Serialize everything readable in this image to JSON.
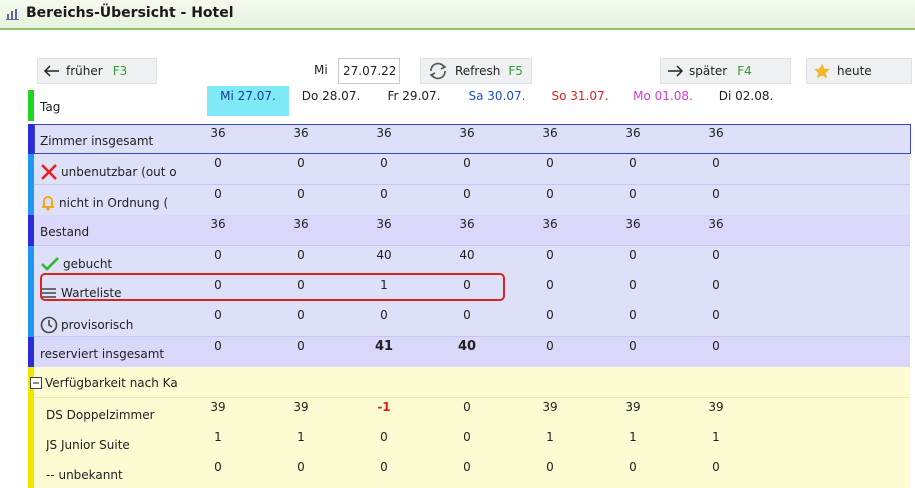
{
  "window": {
    "title": "Bereichs-Übersicht - Hotel"
  },
  "toolbar": {
    "earlier_label": "früher",
    "earlier_key": "F3",
    "date_prefix": "Mi",
    "date_value": "27.07.22",
    "refresh_label": "Refresh",
    "refresh_key": "F5",
    "later_label": "später",
    "later_key": "F4",
    "today_label": "heute"
  },
  "colors": {
    "accent_green": "#2f9e2f",
    "row_bar_blue": "#2b2bd9",
    "row_bar_lightblue": "#2196f3",
    "row_bar_yellow": "#f2e600",
    "negative": "#e02020",
    "highlight": "#d8261f"
  },
  "header": {
    "label": "Tag",
    "days": [
      {
        "label": "Mi 27.07.",
        "color": "#1a3a8a",
        "bg": "#7fe9f7"
      },
      {
        "label": "Do 28.07.",
        "color": "#222222",
        "bg": ""
      },
      {
        "label": "Fr 29.07.",
        "color": "#222222",
        "bg": ""
      },
      {
        "label": "Sa 30.07.",
        "color": "#1c4fd0",
        "bg": ""
      },
      {
        "label": "So 31.07.",
        "color": "#e02020",
        "bg": ""
      },
      {
        "label": "Mo 01.08.",
        "color": "#d43bd4",
        "bg": ""
      },
      {
        "label": "Di 02.08.",
        "color": "#222222",
        "bg": ""
      }
    ]
  },
  "rows": [
    {
      "label": "Zimmer insgesamt",
      "icon": "",
      "values": [
        "36",
        "36",
        "36",
        "36",
        "36",
        "36",
        "36"
      ]
    },
    {
      "label": "unbenutzbar (out o",
      "icon": "x-icon",
      "values": [
        "0",
        "0",
        "0",
        "0",
        "0",
        "0",
        "0"
      ]
    },
    {
      "label": "nicht in Ordnung (",
      "icon": "bell-icon",
      "values": [
        "0",
        "0",
        "0",
        "0",
        "0",
        "0",
        "0"
      ]
    },
    {
      "label": "Bestand",
      "icon": "",
      "values": [
        "36",
        "36",
        "36",
        "36",
        "36",
        "36",
        "36"
      ]
    },
    {
      "label": "gebucht",
      "icon": "check-icon",
      "values": [
        "0",
        "0",
        "40",
        "40",
        "0",
        "0",
        "0"
      ]
    },
    {
      "label": "Warteliste",
      "icon": "list-icon",
      "values": [
        "0",
        "0",
        "1",
        "0",
        "0",
        "0",
        "0"
      ]
    },
    {
      "label": "provisorisch",
      "icon": "clock-icon",
      "values": [
        "0",
        "0",
        "0",
        "0",
        "0",
        "0",
        "0"
      ]
    },
    {
      "label": "reserviert insgesamt",
      "icon": "",
      "values": [
        "0",
        "0",
        "41",
        "40",
        "0",
        "0",
        "0"
      ]
    },
    {
      "label": "Verfügbarkeit nach Ka",
      "icon": "collapse-icon",
      "values": [
        "",
        "",
        "",
        "",
        "",
        "",
        ""
      ]
    },
    {
      "label": "DS Doppelzimmer",
      "icon": "",
      "values": [
        "39",
        "39",
        "-1",
        "0",
        "39",
        "39",
        "39"
      ]
    },
    {
      "label": "JS Junior Suite",
      "icon": "",
      "values": [
        "1",
        "1",
        "0",
        "0",
        "1",
        "1",
        "1"
      ]
    },
    {
      "label": "-- unbekannt",
      "icon": "",
      "values": [
        "0",
        "0",
        "0",
        "0",
        "0",
        "0",
        "0"
      ]
    }
  ]
}
